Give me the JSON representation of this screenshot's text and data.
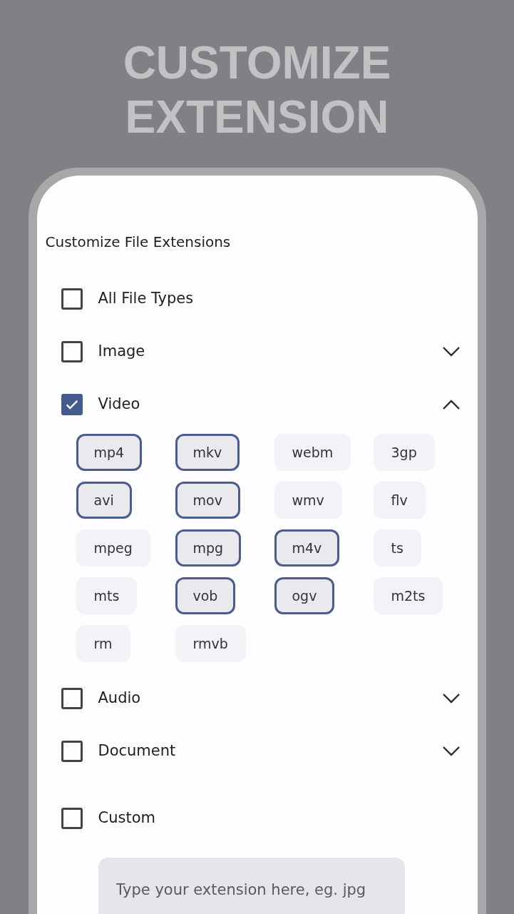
{
  "banner": {
    "lines": [
      "CUSTOMIZE",
      "EXTENSION"
    ]
  },
  "heading": "Customize File Extensions",
  "categories": [
    {
      "kind": "plain",
      "label": "All File Types",
      "checked": false
    },
    {
      "kind": "expandable",
      "label": "Image",
      "checked": false,
      "expanded": false
    },
    {
      "kind": "expandable",
      "label": "Video",
      "checked": true,
      "expanded": true,
      "extensions": [
        {
          "label": "mp4",
          "selected": true
        },
        {
          "label": "mkv",
          "selected": true
        },
        {
          "label": "webm",
          "selected": false
        },
        {
          "label": "3gp",
          "selected": false
        },
        {
          "label": "avi",
          "selected": true
        },
        {
          "label": "mov",
          "selected": true
        },
        {
          "label": "wmv",
          "selected": false
        },
        {
          "label": "flv",
          "selected": false
        },
        {
          "label": "mpeg",
          "selected": false
        },
        {
          "label": "mpg",
          "selected": true
        },
        {
          "label": "m4v",
          "selected": true
        },
        {
          "label": "ts",
          "selected": false
        },
        {
          "label": "mts",
          "selected": false
        },
        {
          "label": "vob",
          "selected": true
        },
        {
          "label": "ogv",
          "selected": true
        },
        {
          "label": "m2ts",
          "selected": false
        },
        {
          "label": "rm",
          "selected": false
        },
        {
          "label": "rmvb",
          "selected": false
        }
      ]
    },
    {
      "kind": "expandable",
      "label": "Audio",
      "checked": false,
      "expanded": false
    },
    {
      "kind": "expandable",
      "label": "Document",
      "checked": false,
      "expanded": false
    },
    {
      "kind": "plain",
      "label": "Custom",
      "checked": false
    }
  ],
  "custom_field": {
    "placeholder": "Type your extension here, eg. jpg"
  }
}
